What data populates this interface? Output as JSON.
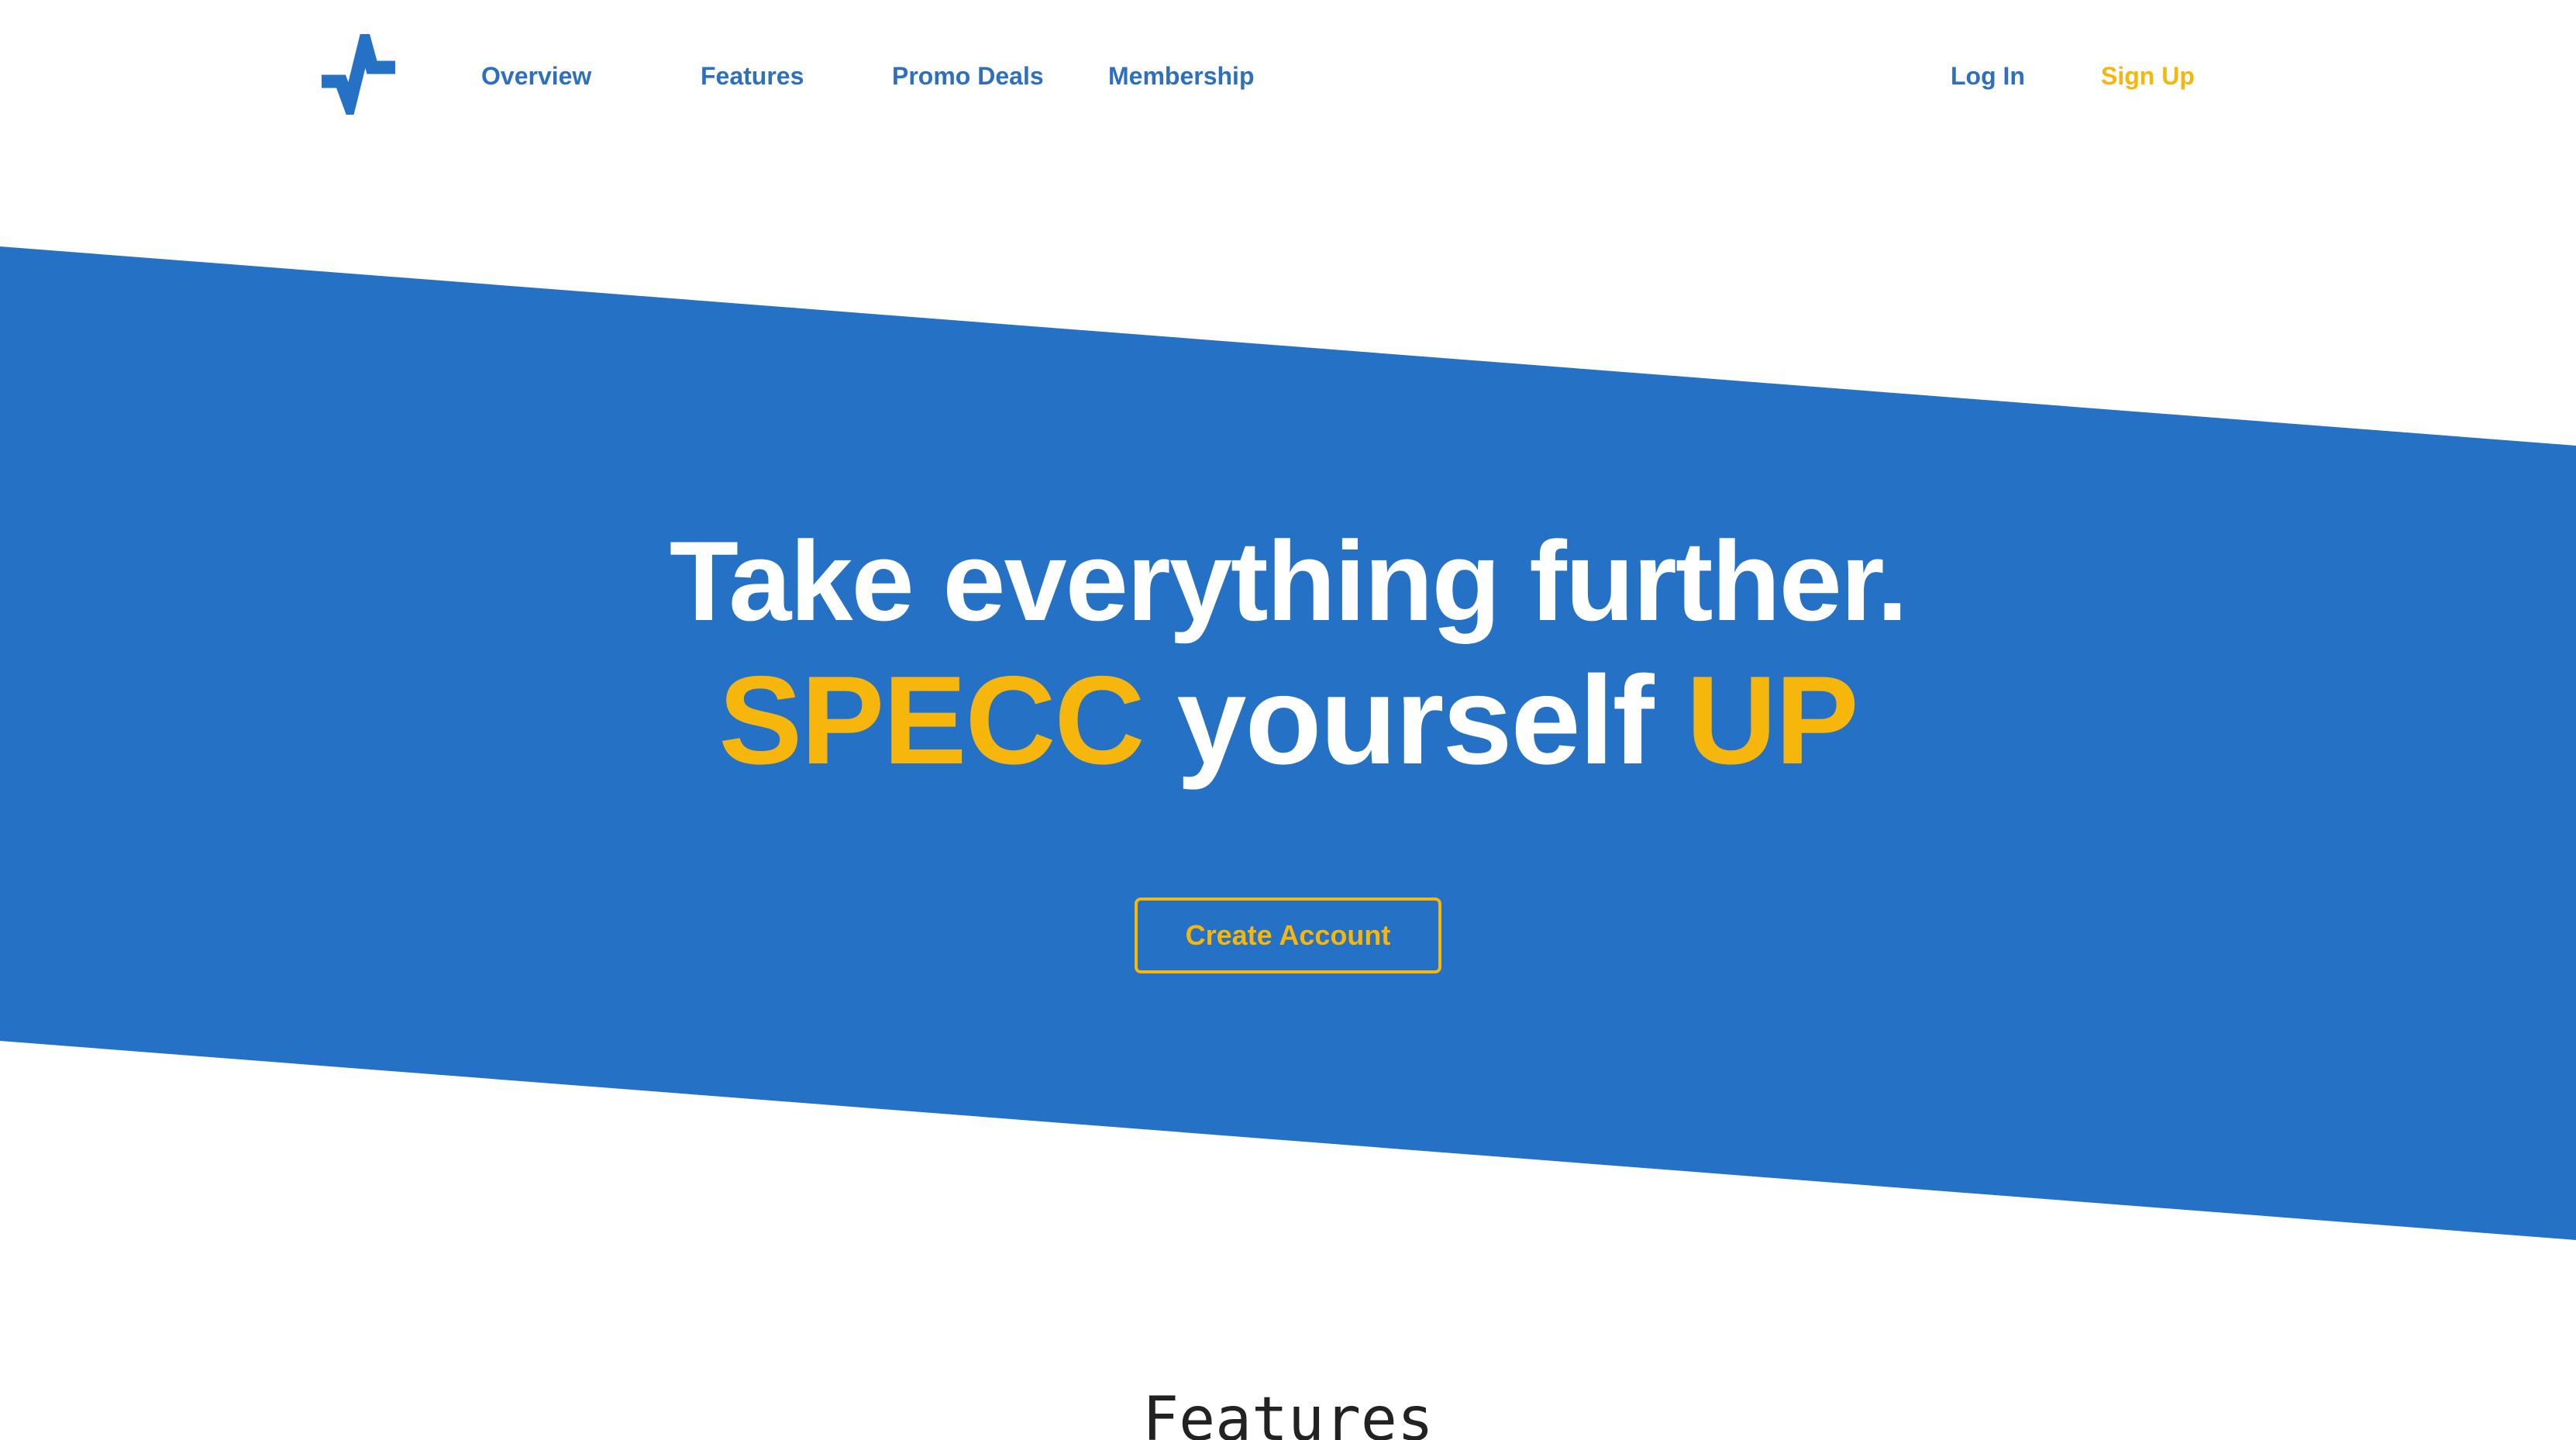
{
  "nav": {
    "logo_icon": "pulse-logo-icon",
    "links": {
      "overview": "Overview",
      "features": "Features",
      "promo_deals": "Promo Deals",
      "membership": "Membership"
    },
    "login": "Log In",
    "signup": "Sign Up"
  },
  "hero": {
    "headline_line1": "Take everything further.",
    "headline_line2": {
      "word1": "SPECC",
      "word2": "yourself",
      "word3": "UP"
    },
    "cta_label": "Create Account"
  },
  "sections": {
    "features_title": "Features"
  },
  "colors": {
    "primary_blue": "#2571c5",
    "accent_yellow": "#f6b60c",
    "nav_text_blue": "#2e6fbe",
    "background": "#ffffff"
  }
}
